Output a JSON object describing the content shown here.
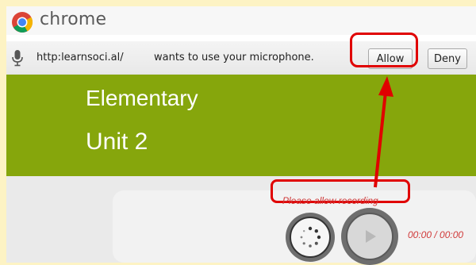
{
  "window": {
    "app_name": "chrome"
  },
  "infobar": {
    "url": "http:learnsoci.al/",
    "message": "wants to use your microphone.",
    "allow_label": "Allow",
    "deny_label": "Deny"
  },
  "banner": {
    "level": "Elementary",
    "unit": "Unit 2"
  },
  "recorder": {
    "status_text": "Please allow recording",
    "time": "00:00 / 00:00"
  },
  "colors": {
    "banner_green": "#86a60c",
    "highlight_red": "#e00000",
    "status_red": "#d03a3a",
    "page_background": "#fdf3c4"
  },
  "icons": [
    "chrome-logo-icon",
    "microphone-icon",
    "record-spinner-icon",
    "play-icon",
    "annotation-arrow-icon"
  ]
}
